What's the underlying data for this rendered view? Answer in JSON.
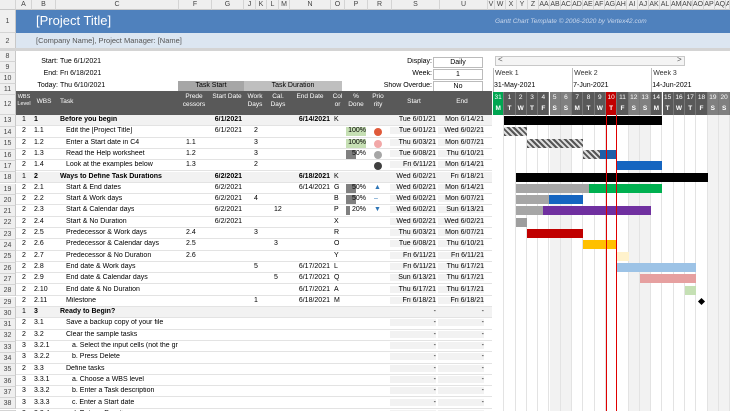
{
  "sheet": {
    "col_letters": [
      "A",
      "B",
      "C",
      "F",
      "G",
      "J",
      "K",
      "L",
      "M",
      "N",
      "O",
      "P",
      "R",
      "S",
      "U",
      "V",
      "W",
      "X",
      "Y",
      "Z",
      "AA",
      "AB",
      "AC",
      "AD",
      "AE",
      "AF",
      "AG",
      "AH",
      "AI",
      "AJ",
      "AK",
      "AL",
      "AM",
      "AN",
      "AO",
      "AP",
      "AQ",
      "AR",
      "AS"
    ],
    "row_numbers": [
      "1",
      "2",
      "8",
      "9",
      "10",
      "11",
      "12",
      "13",
      "14",
      "15",
      "16",
      "17",
      "18",
      "19",
      "20",
      "21",
      "22",
      "23",
      "24",
      "25",
      "26",
      "27",
      "28",
      "29",
      "30",
      "31",
      "32",
      "33",
      "34",
      "35",
      "36",
      "37",
      "38",
      "39"
    ]
  },
  "header": {
    "title": "[Project Title]",
    "company": "[Company Name], Project Manager: [Name]",
    "template_credit": "Gantt Chart Template © 2006-2020 by Vertex42.com"
  },
  "settings": {
    "start_label": "Start:",
    "start_value": "Tue 6/1/2021",
    "end_label": "End:",
    "end_value": "Fri 6/18/2021",
    "today_label": "Today:",
    "today_value": "Thu 6/10/2021",
    "display_label": "Display:",
    "display_value": "Daily",
    "week_label": "Week:",
    "week_value": "1",
    "overdue_label": "Show Overdue:",
    "overdue_value": "No"
  },
  "scroll": {
    "left": "<",
    "right": ">"
  },
  "group_headers": {
    "task_start": "Task Start",
    "task_duration": "Task Duration"
  },
  "col_headers": {
    "wbs_level": "WBS Level",
    "wbs": "WBS",
    "task": "Task",
    "predecessors": "Prede cessors",
    "start_date": "Start Date",
    "work_days": "Work Days",
    "cal_days": "Cal. Days",
    "end_date": "End Date",
    "color": "Col or",
    "done": "% Done",
    "priority": "Prio rity",
    "start": "Start",
    "end": "End"
  },
  "weeks": [
    {
      "label": "Week 1",
      "date": "31-May-2021"
    },
    {
      "label": "Week 2",
      "date": "7-Jun-2021"
    },
    {
      "label": "Week 3",
      "date": "14-Jun-2021"
    }
  ],
  "days": [
    {
      "num": "31",
      "dow": "M"
    },
    {
      "num": "1",
      "dow": "T"
    },
    {
      "num": "2",
      "dow": "W"
    },
    {
      "num": "3",
      "dow": "T"
    },
    {
      "num": "4",
      "dow": "F"
    },
    {
      "num": "5",
      "dow": "S"
    },
    {
      "num": "6",
      "dow": "S"
    },
    {
      "num": "7",
      "dow": "M"
    },
    {
      "num": "8",
      "dow": "T"
    },
    {
      "num": "9",
      "dow": "W"
    },
    {
      "num": "10",
      "dow": "T"
    },
    {
      "num": "11",
      "dow": "F"
    },
    {
      "num": "12",
      "dow": "S"
    },
    {
      "num": "13",
      "dow": "S"
    },
    {
      "num": "14",
      "dow": "M"
    },
    {
      "num": "15",
      "dow": "T"
    },
    {
      "num": "16",
      "dow": "W"
    },
    {
      "num": "17",
      "dow": "T"
    },
    {
      "num": "18",
      "dow": "F"
    },
    {
      "num": "19",
      "dow": "S"
    },
    {
      "num": "20",
      "dow": "S"
    }
  ],
  "rows": [
    {
      "lvl": "1",
      "wbs": "1",
      "task": "Before you begin",
      "pred": "",
      "sdate": "6/1/2021",
      "work": "",
      "cal": "",
      "edate": "6/14/2021",
      "color": "K",
      "done": "",
      "prio": "",
      "start": "Tue 6/01/21",
      "end": "Mon 6/14/21",
      "bold": true,
      "indent": 0
    },
    {
      "lvl": "2",
      "wbs": "1.1",
      "task": "Edit the [Project Title]",
      "pred": "",
      "sdate": "6/1/2021",
      "work": "2",
      "cal": "",
      "edate": "",
      "color": "",
      "done": "100%",
      "prio": "red",
      "start": "Tue 6/01/21",
      "end": "Wed 6/02/21",
      "bold": false,
      "indent": 1
    },
    {
      "lvl": "2",
      "wbs": "1.2",
      "task": "Enter a Start date in C4",
      "pred": "1.1",
      "sdate": "",
      "work": "3",
      "cal": "",
      "edate": "",
      "color": "",
      "done": "100%",
      "prio": "pink",
      "start": "Thu 6/03/21",
      "end": "Mon 6/07/21",
      "bold": false,
      "indent": 1
    },
    {
      "lvl": "2",
      "wbs": "1.3",
      "task": "Read the Help worksheet",
      "pred": "1.2",
      "sdate": "",
      "work": "3",
      "cal": "",
      "edate": "",
      "color": "",
      "done": "50%",
      "prio": "gray",
      "start": "Tue 6/08/21",
      "end": "Thu 6/10/21",
      "bold": false,
      "indent": 1
    },
    {
      "lvl": "2",
      "wbs": "1.4",
      "task": "Look at the examples below",
      "pred": "1.3",
      "sdate": "",
      "work": "2",
      "cal": "",
      "edate": "",
      "color": "",
      "done": "",
      "prio": "dark",
      "start": "Fri 6/11/21",
      "end": "Mon 6/14/21",
      "bold": false,
      "indent": 1
    },
    {
      "lvl": "1",
      "wbs": "2",
      "task": "Ways to Define Task Durations",
      "pred": "",
      "sdate": "6/2/2021",
      "work": "",
      "cal": "",
      "edate": "6/18/2021",
      "color": "K",
      "done": "",
      "prio": "",
      "start": "Wed 6/02/21",
      "end": "Fri 6/18/21",
      "bold": true,
      "indent": 0
    },
    {
      "lvl": "2",
      "wbs": "2.1",
      "task": "Start & End dates",
      "pred": "",
      "sdate": "6/2/2021",
      "work": "",
      "cal": "",
      "edate": "6/14/2021",
      "color": "G",
      "done": "50%",
      "prio": "up",
      "start": "Wed 6/02/21",
      "end": "Mon 6/14/21",
      "bold": false,
      "indent": 1
    },
    {
      "lvl": "2",
      "wbs": "2.2",
      "task": "Start & Work days",
      "pred": "",
      "sdate": "6/2/2021",
      "work": "4",
      "cal": "",
      "edate": "",
      "color": "B",
      "done": "50%",
      "prio": "dash",
      "start": "Wed 6/02/21",
      "end": "Mon 6/07/21",
      "bold": false,
      "indent": 1
    },
    {
      "lvl": "2",
      "wbs": "2.3",
      "task": "Start & Calendar days",
      "pred": "",
      "sdate": "6/2/2021",
      "work": "",
      "cal": "12",
      "edate": "",
      "color": "P",
      "done": "20%",
      "prio": "down",
      "start": "Wed 6/02/21",
      "end": "Sun 6/13/21",
      "bold": false,
      "indent": 1
    },
    {
      "lvl": "2",
      "wbs": "2.4",
      "task": "Start & No Duration",
      "pred": "",
      "sdate": "6/2/2021",
      "work": "",
      "cal": "",
      "edate": "",
      "color": "X",
      "done": "",
      "prio": "",
      "start": "Wed 6/02/21",
      "end": "Wed 6/02/21",
      "bold": false,
      "indent": 1
    },
    {
      "lvl": "2",
      "wbs": "2.5",
      "task": "Predecessor & Work days",
      "pred": "2.4",
      "sdate": "",
      "work": "3",
      "cal": "",
      "edate": "",
      "color": "R",
      "done": "",
      "prio": "",
      "start": "Thu 6/03/21",
      "end": "Mon 6/07/21",
      "bold": false,
      "indent": 1
    },
    {
      "lvl": "2",
      "wbs": "2.6",
      "task": "Predecessor & Calendar days",
      "pred": "2.5",
      "sdate": "",
      "work": "",
      "cal": "3",
      "edate": "",
      "color": "O",
      "done": "",
      "prio": "",
      "start": "Tue 6/08/21",
      "end": "Thu 6/10/21",
      "bold": false,
      "indent": 1
    },
    {
      "lvl": "2",
      "wbs": "2.7",
      "task": "Predecessor & No Duration",
      "pred": "2.6",
      "sdate": "",
      "work": "",
      "cal": "",
      "edate": "",
      "color": "Y",
      "done": "",
      "prio": "",
      "start": "Fri 6/11/21",
      "end": "Fri 6/11/21",
      "bold": false,
      "indent": 1
    },
    {
      "lvl": "2",
      "wbs": "2.8",
      "task": "End date & Work days",
      "pred": "",
      "sdate": "",
      "work": "5",
      "cal": "",
      "edate": "6/17/2021",
      "color": "L",
      "done": "",
      "prio": "",
      "start": "Fri 6/11/21",
      "end": "Thu 6/17/21",
      "bold": false,
      "indent": 1
    },
    {
      "lvl": "2",
      "wbs": "2.9",
      "task": "End date & Calendar days",
      "pred": "",
      "sdate": "",
      "work": "",
      "cal": "5",
      "edate": "6/17/2021",
      "color": "Q",
      "done": "",
      "prio": "",
      "start": "Sun 6/13/21",
      "end": "Thu 6/17/21",
      "bold": false,
      "indent": 1
    },
    {
      "lvl": "2",
      "wbs": "2.10",
      "task": "End date & No Duration",
      "pred": "",
      "sdate": "",
      "work": "",
      "cal": "",
      "edate": "6/17/2021",
      "color": "A",
      "done": "",
      "prio": "",
      "start": "Thu 6/17/21",
      "end": "Thu 6/17/21",
      "bold": false,
      "indent": 1
    },
    {
      "lvl": "2",
      "wbs": "2.11",
      "task": "Milestone",
      "pred": "",
      "sdate": "",
      "work": "1",
      "cal": "",
      "edate": "6/18/2021",
      "color": "M",
      "done": "",
      "prio": "",
      "start": "Fri 6/18/21",
      "end": "Fri 6/18/21",
      "bold": false,
      "indent": 1
    },
    {
      "lvl": "1",
      "wbs": "3",
      "task": "Ready to Begin?",
      "pred": "",
      "sdate": "",
      "work": "",
      "cal": "",
      "edate": "",
      "color": "",
      "done": "",
      "prio": "",
      "start": "-",
      "end": "-",
      "bold": true,
      "indent": 0
    },
    {
      "lvl": "2",
      "wbs": "3.1",
      "task": "Save a backup copy of your file",
      "pred": "",
      "sdate": "",
      "work": "",
      "cal": "",
      "edate": "",
      "color": "",
      "done": "",
      "prio": "",
      "start": "-",
      "end": "-",
      "bold": false,
      "indent": 1
    },
    {
      "lvl": "2",
      "wbs": "3.2",
      "task": "Clear the sample tasks",
      "pred": "",
      "sdate": "",
      "work": "",
      "cal": "",
      "edate": "",
      "color": "",
      "done": "",
      "prio": "",
      "start": "-",
      "end": "-",
      "bold": false,
      "indent": 1
    },
    {
      "lvl": "3",
      "wbs": "3.2.1",
      "task": "a. Select the input cells (not the gray columns)",
      "pred": "",
      "sdate": "",
      "work": "",
      "cal": "",
      "edate": "",
      "color": "",
      "done": "",
      "prio": "",
      "start": "-",
      "end": "-",
      "bold": false,
      "indent": 2
    },
    {
      "lvl": "3",
      "wbs": "3.2.2",
      "task": "b. Press Delete",
      "pred": "",
      "sdate": "",
      "work": "",
      "cal": "",
      "edate": "",
      "color": "",
      "done": "",
      "prio": "",
      "start": "-",
      "end": "-",
      "bold": false,
      "indent": 2
    },
    {
      "lvl": "2",
      "wbs": "3.3",
      "task": "Define tasks",
      "pred": "",
      "sdate": "",
      "work": "",
      "cal": "",
      "edate": "",
      "color": "",
      "done": "",
      "prio": "",
      "start": "-",
      "end": "-",
      "bold": false,
      "indent": 1
    },
    {
      "lvl": "3",
      "wbs": "3.3.1",
      "task": "a. Choose a WBS level",
      "pred": "",
      "sdate": "",
      "work": "",
      "cal": "",
      "edate": "",
      "color": "",
      "done": "",
      "prio": "",
      "start": "-",
      "end": "-",
      "bold": false,
      "indent": 2
    },
    {
      "lvl": "3",
      "wbs": "3.3.2",
      "task": "b. Enter a Task description",
      "pred": "",
      "sdate": "",
      "work": "",
      "cal": "",
      "edate": "",
      "color": "",
      "done": "",
      "prio": "",
      "start": "-",
      "end": "-",
      "bold": false,
      "indent": 2
    },
    {
      "lvl": "3",
      "wbs": "3.3.3",
      "task": "c. Enter a Start date",
      "pred": "",
      "sdate": "",
      "work": "",
      "cal": "",
      "edate": "",
      "color": "",
      "done": "",
      "prio": "",
      "start": "-",
      "end": "-",
      "bold": false,
      "indent": 2
    },
    {
      "lvl": "3",
      "wbs": "3.3.4",
      "task": "d. Enter a Duration",
      "pred": "",
      "sdate": "",
      "work": "",
      "cal": "",
      "edate": "",
      "color": "",
      "done": "",
      "prio": "",
      "start": "-",
      "end": "-",
      "bold": false,
      "indent": 2
    }
  ],
  "bars": [
    {
      "row": 0,
      "start": 1,
      "len": 14,
      "color": "#000000",
      "done": 0
    },
    {
      "row": 1,
      "start": 1,
      "len": 2,
      "color": "#000000",
      "done": 1,
      "hatch": true
    },
    {
      "row": 2,
      "start": 3,
      "len": 5,
      "color": "#000000",
      "done": 1,
      "hatch": true
    },
    {
      "row": 3,
      "start": 8,
      "len": 3,
      "color": "#1f5fa8",
      "done": 0.5,
      "hatch": true
    },
    {
      "row": 4,
      "start": 11,
      "len": 4,
      "color": "#1565c0",
      "done": 0
    },
    {
      "row": 5,
      "start": 2,
      "len": 17,
      "color": "#000000",
      "done": 0
    },
    {
      "row": 6,
      "start": 2,
      "len": 13,
      "color": "#00b050",
      "done": 0.5
    },
    {
      "row": 7,
      "start": 2,
      "len": 6,
      "color": "#1565c0",
      "done": 0.5
    },
    {
      "row": 8,
      "start": 2,
      "len": 12,
      "color": "#7030a0",
      "done": 0.2
    },
    {
      "row": 9,
      "start": 2,
      "len": 1,
      "color": "#9e9e9e",
      "done": 0
    },
    {
      "row": 10,
      "start": 3,
      "len": 5,
      "color": "#c00000",
      "done": 0
    },
    {
      "row": 11,
      "start": 8,
      "len": 3,
      "color": "#ffc000",
      "done": 0
    },
    {
      "row": 12,
      "start": 11,
      "len": 1,
      "color": "#fff2cc",
      "done": 0
    },
    {
      "row": 13,
      "start": 11,
      "len": 7,
      "color": "#9dc3e6",
      "done": 0
    },
    {
      "row": 14,
      "start": 13,
      "len": 5,
      "color": "#e6a0a0",
      "done": 0
    },
    {
      "row": 15,
      "start": 17,
      "len": 1,
      "color": "#c5e0b4",
      "done": 0
    },
    {
      "row": 16,
      "start": 18,
      "len": 1,
      "color": "#000000",
      "done": 0,
      "milestone": true
    }
  ],
  "today_index": 10,
  "colors": {
    "title_bar": "#4f81bd",
    "header_dark": "#595959",
    "gray_header": "#a6a6a6",
    "today_line": "#e00000",
    "done_fill": "#70ad47"
  }
}
